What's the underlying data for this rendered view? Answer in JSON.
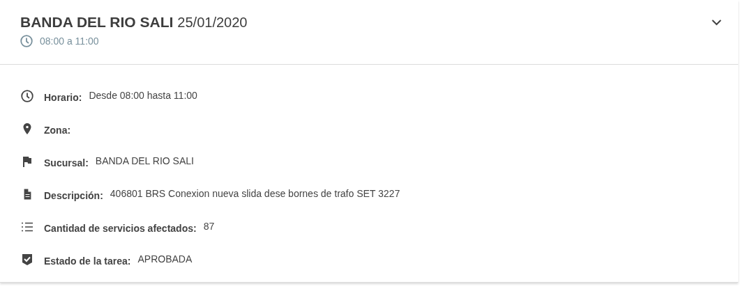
{
  "header": {
    "title": "BANDA DEL RIO SALI",
    "date": "25/01/2020",
    "time_range": "08:00 a 11:00"
  },
  "details": [
    {
      "kind": "schedule",
      "label": "Horario:",
      "value": "Desde 08:00 hasta 11:00"
    },
    {
      "kind": "zone",
      "label": "Zona:"
    },
    {
      "kind": "branch",
      "label": "Sucursal:",
      "value": "BANDA DEL RIO SALI"
    },
    {
      "kind": "description",
      "label": "Descripción:",
      "value": "406801 BRS Conexion nueva slida dese bornes de trafo SET 3227"
    },
    {
      "kind": "count",
      "label": "Cantidad de servicios afectados:",
      "value": "87"
    },
    {
      "kind": "status",
      "label": "Estado de la tarea:",
      "value": "APROBADA"
    }
  ]
}
